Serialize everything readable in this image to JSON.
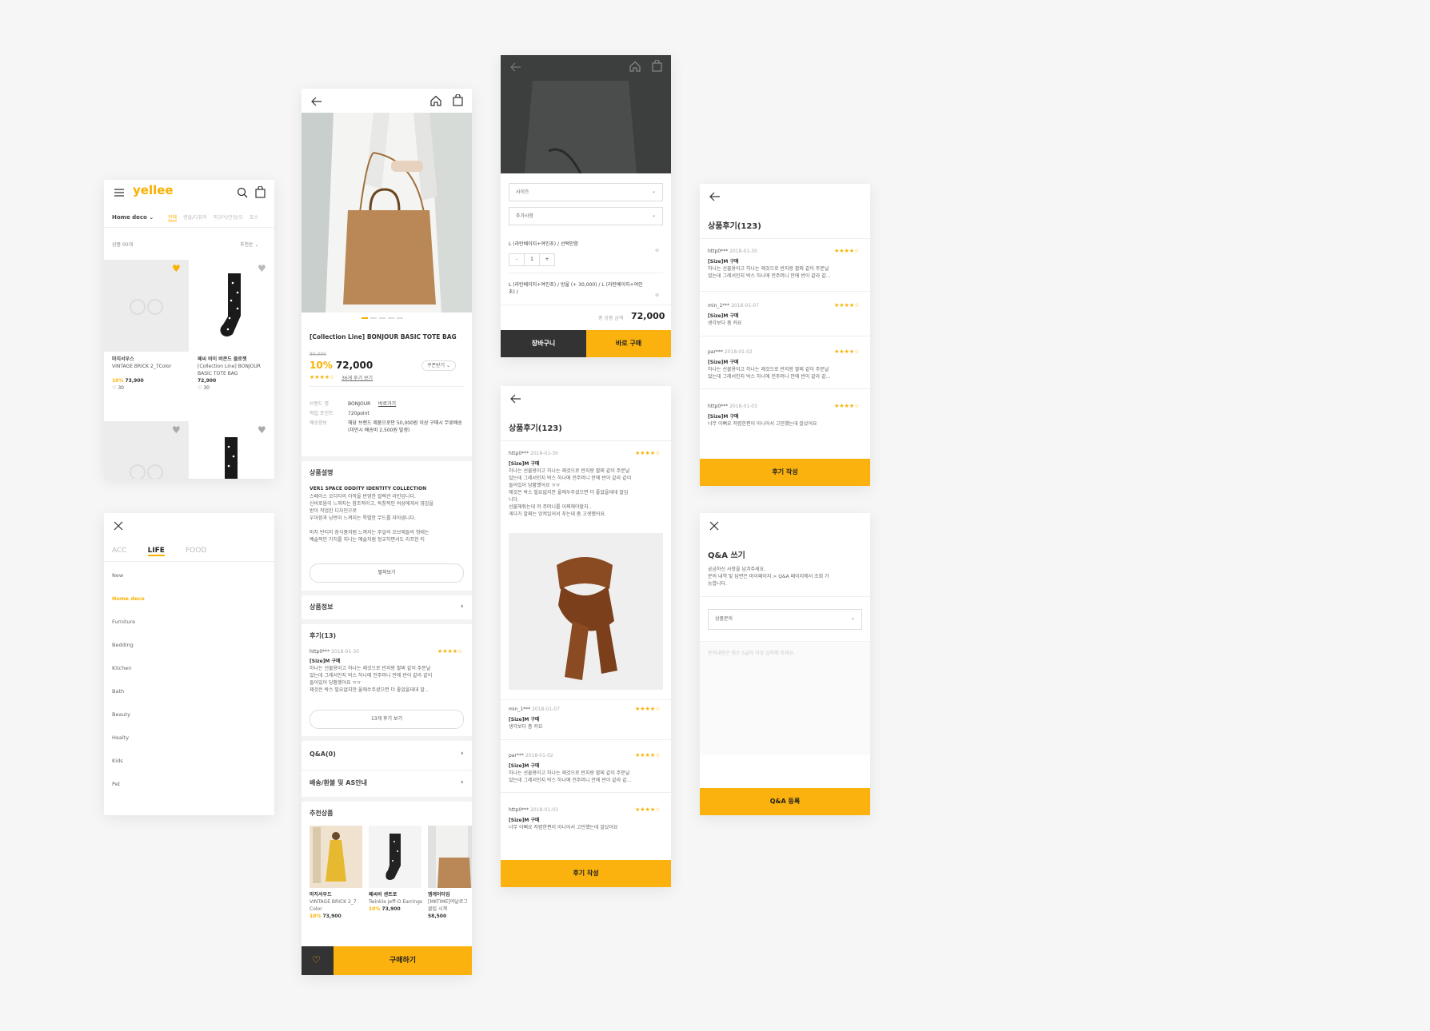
{
  "colors": {
    "accent": "#fbb20e",
    "text": "#333333",
    "muted": "#aaaaaa",
    "bg": "#f6f6f6"
  },
  "list": {
    "logo": "yellee",
    "category": "Home deco",
    "tabs": [
      "전체",
      "캔들/디퓨저",
      "피규어/인형/오",
      "포스"
    ],
    "filter_label": "상품 00개",
    "sort_label": "추천순",
    "products": [
      {
        "brand": "마지서우스",
        "name": "VINTAGE BRICK 2_7Color",
        "discount": "10%",
        "price": "73,900",
        "likes": "30",
        "liked": true
      },
      {
        "brand": "페씨 바이 버콘드 클로젯",
        "name": "[Collection Line] BONJOUR BASIC TOTE BAG",
        "price": "72,900",
        "likes": "30",
        "liked": false
      }
    ]
  },
  "menu": {
    "tabs": [
      "ACC",
      "LIFE",
      "FOOD"
    ],
    "items": [
      "New",
      "Home deco",
      "Furniture",
      "Bedding",
      "Kitchen",
      "Bath",
      "Beauty",
      "Healty",
      "Kids",
      "Pet"
    ]
  },
  "detail": {
    "dots": 5,
    "title": "[Collection Line] BONJOUR BASIC TOTE BAG",
    "orig_price": "80,000",
    "discount": "10%",
    "price": "72,000",
    "coupon": "쿠폰받기",
    "stars": "★★★★☆",
    "review_link": "36개 후기 보기",
    "info": [
      {
        "k": "브랜드 명",
        "v": "BONJOUR",
        "link": "바로가기"
      },
      {
        "k": "적립 포인트",
        "v": "720point"
      },
      {
        "k": "배송정보",
        "v": "해당 브랜드 제품으로만 50,000원 이상 구매시 무료배송 (미만시 배송비 2,500원 발생)"
      }
    ],
    "desc_title": "상품설명",
    "desc_sub": "VER1 SPACE ODDITY IDENTITY COLLECTION",
    "desc_lines": [
      "스페이스 오디티의 아작을 반영한 컬렉션 라인입니다.",
      "신비로움이 느껴지는 참조적이고, 독창적인 여성에게서 영감을",
      "받아 작업한 디자인으로",
      "우아함과 낭만이 느껴지는 특별한 무드를 자아냅니다.",
      "",
      "마치 빈티지 장식품처럼 느껴지는 주얼의 오브제들의 형태는",
      "예술적인 가치를 지니는 예술처럼 정교하면서도 리프한 티"
    ],
    "more_btn": "펼쳐보기",
    "product_info": "상품정보",
    "reviews_title": "후기(13)",
    "review": {
      "user": "http0***",
      "date": "2018-01-30",
      "opt": "[Size]M 구매",
      "lines": [
        "하나는 선물용이고 하나는 제것으로 반지랑 팔찌 같이 주문날",
        "었는데 그레서인지 박스 하나에 전주머니 안에 반이 같라 같이",
        "들어있어 당황했어요 ㅠㅠ",
        "제것은 박스 필요없지만 울에쑤주셨으면 더 좋았을테데 말..."
      ]
    },
    "all_reviews_btn": "13개 후기 보기",
    "qa": "Q&A(0)",
    "shipping": "배송/환불 및 AS안내",
    "rec_title": "추천상품",
    "recs": [
      {
        "brand": "마지서우드",
        "name": "VINTAGE BRICK 2_7 Color",
        "discount": "10%",
        "price": "73,900"
      },
      {
        "brand": "페씨비 센트로",
        "name": "Twinkle Jeff-O Earrings",
        "discount": "10%",
        "price": "73,900"
      },
      {
        "brand": "엠케이타임",
        "name": "[MKTIME]여날로그 클립 시계",
        "price": "58,500"
      }
    ],
    "buy_btn": "구매하기"
  },
  "option": {
    "select1": "사이즈",
    "select2": "추가사항",
    "item1": "L (라탄베이지+여인초) / 선택안함",
    "qty": "1",
    "item2": "L (라탄베이지+여인초) / 방울 (+ 30,000) / L (라탄베이지+여인초) /",
    "total_label": "총 상품 금액",
    "total": "72,000",
    "cart_btn": "장바구니",
    "buy_btn": "바로 구매"
  },
  "reviews_mid": {
    "title": "상품후기(123)",
    "r1": {
      "user": "http0***",
      "date": "2018-01-30",
      "opt": "[Size]M 구매",
      "lines": [
        "하나는 선물용이고 하나는 제것으로 반지랑 팔찌 같이 주문날",
        "었는데 그레서인지 박스 하나에 전주머니 안에 반이 같라 같이",
        "들어있어 당황했어요 ㅠㅠ",
        "제것은 박스 필요없지만 울에쑤주셨으면 더 좋았을테데 말입",
        "니다.",
        "선물해줘는데 저 주머니를 어쩌해야할지..",
        "게다가 발찌는 엉켜있어서 푸는데 좀 고생했어요."
      ]
    },
    "r2": {
      "user": "min_1***",
      "date": "2018-01-07",
      "opt": "[Size]M 구매",
      "lines": [
        "생각보다 좀 커요"
      ]
    },
    "r3": {
      "user": "par***",
      "date": "2018-01-02",
      "opt": "[Size]M 구매",
      "lines": [
        "하나는 선물용이고 하나는 제것으로 반지랑 팔찌 같이 주문날",
        "었는데 그레서인지 박스 하나에 전주머니 안에 반이 같라 같..."
      ]
    },
    "r4": {
      "user": "http0***",
      "date": "2018-01-03",
      "opt": "[Size]M 구매",
      "lines": [
        "너무 이뻐요 저렴한편이 아니어서 고민했는데 잘샀어요"
      ]
    },
    "write_btn": "후기 작성"
  },
  "reviews_right": {
    "title": "상품후기(123)",
    "r1": {
      "user": "http0***",
      "date": "2018-01-30",
      "opt": "[Size]M 구매",
      "lines": [
        "하나는 선물용이고 하나는 제것으로 반지랑 팔찌 같이 주문날",
        "었는데 그레서인지 박스 하나에 전주머니 안에 반이 같라 같..."
      ]
    },
    "r2": {
      "user": "min_1***",
      "date": "2018-01-07",
      "opt": "[Size]M 구매",
      "lines": [
        "생각보다 좀 커요"
      ]
    },
    "r3": {
      "user": "par***",
      "date": "2018-01-02",
      "opt": "[Size]M 구매",
      "lines": [
        "하나는 선물용이고 하나는 제것으로 반지랑 팔찌 같이 주문날",
        "었는데 그레서인지 박스 하나에 전주머니 안에 반이 같라 같..."
      ]
    },
    "r4": {
      "user": "http0***",
      "date": "2018-01-03",
      "opt": "[Size]M 구매",
      "lines": [
        "너무 이뻐요 저렴한편이 아니어서 고민했는데 잘샀어요"
      ]
    },
    "write_btn": "후기 작성"
  },
  "qa_write": {
    "title": "Q&A 쓰기",
    "desc": [
      "궁금하신 사항을 남겨주세요.",
      "문의 내역 및 답변은 마이페이지 > Q&A 페이지에서 조회 가",
      "능합니다."
    ],
    "select": "상품문의",
    "placeholder": "문의내용은 최소 5글자 이상 입력해 주세요.",
    "submit_btn": "Q&A 등록"
  },
  "icons": [
    "hamburger-icon",
    "search-icon",
    "bag-icon",
    "heart-icon",
    "back-arrow-icon",
    "home-icon",
    "close-icon",
    "chevron-down-icon",
    "chevron-right-icon"
  ]
}
